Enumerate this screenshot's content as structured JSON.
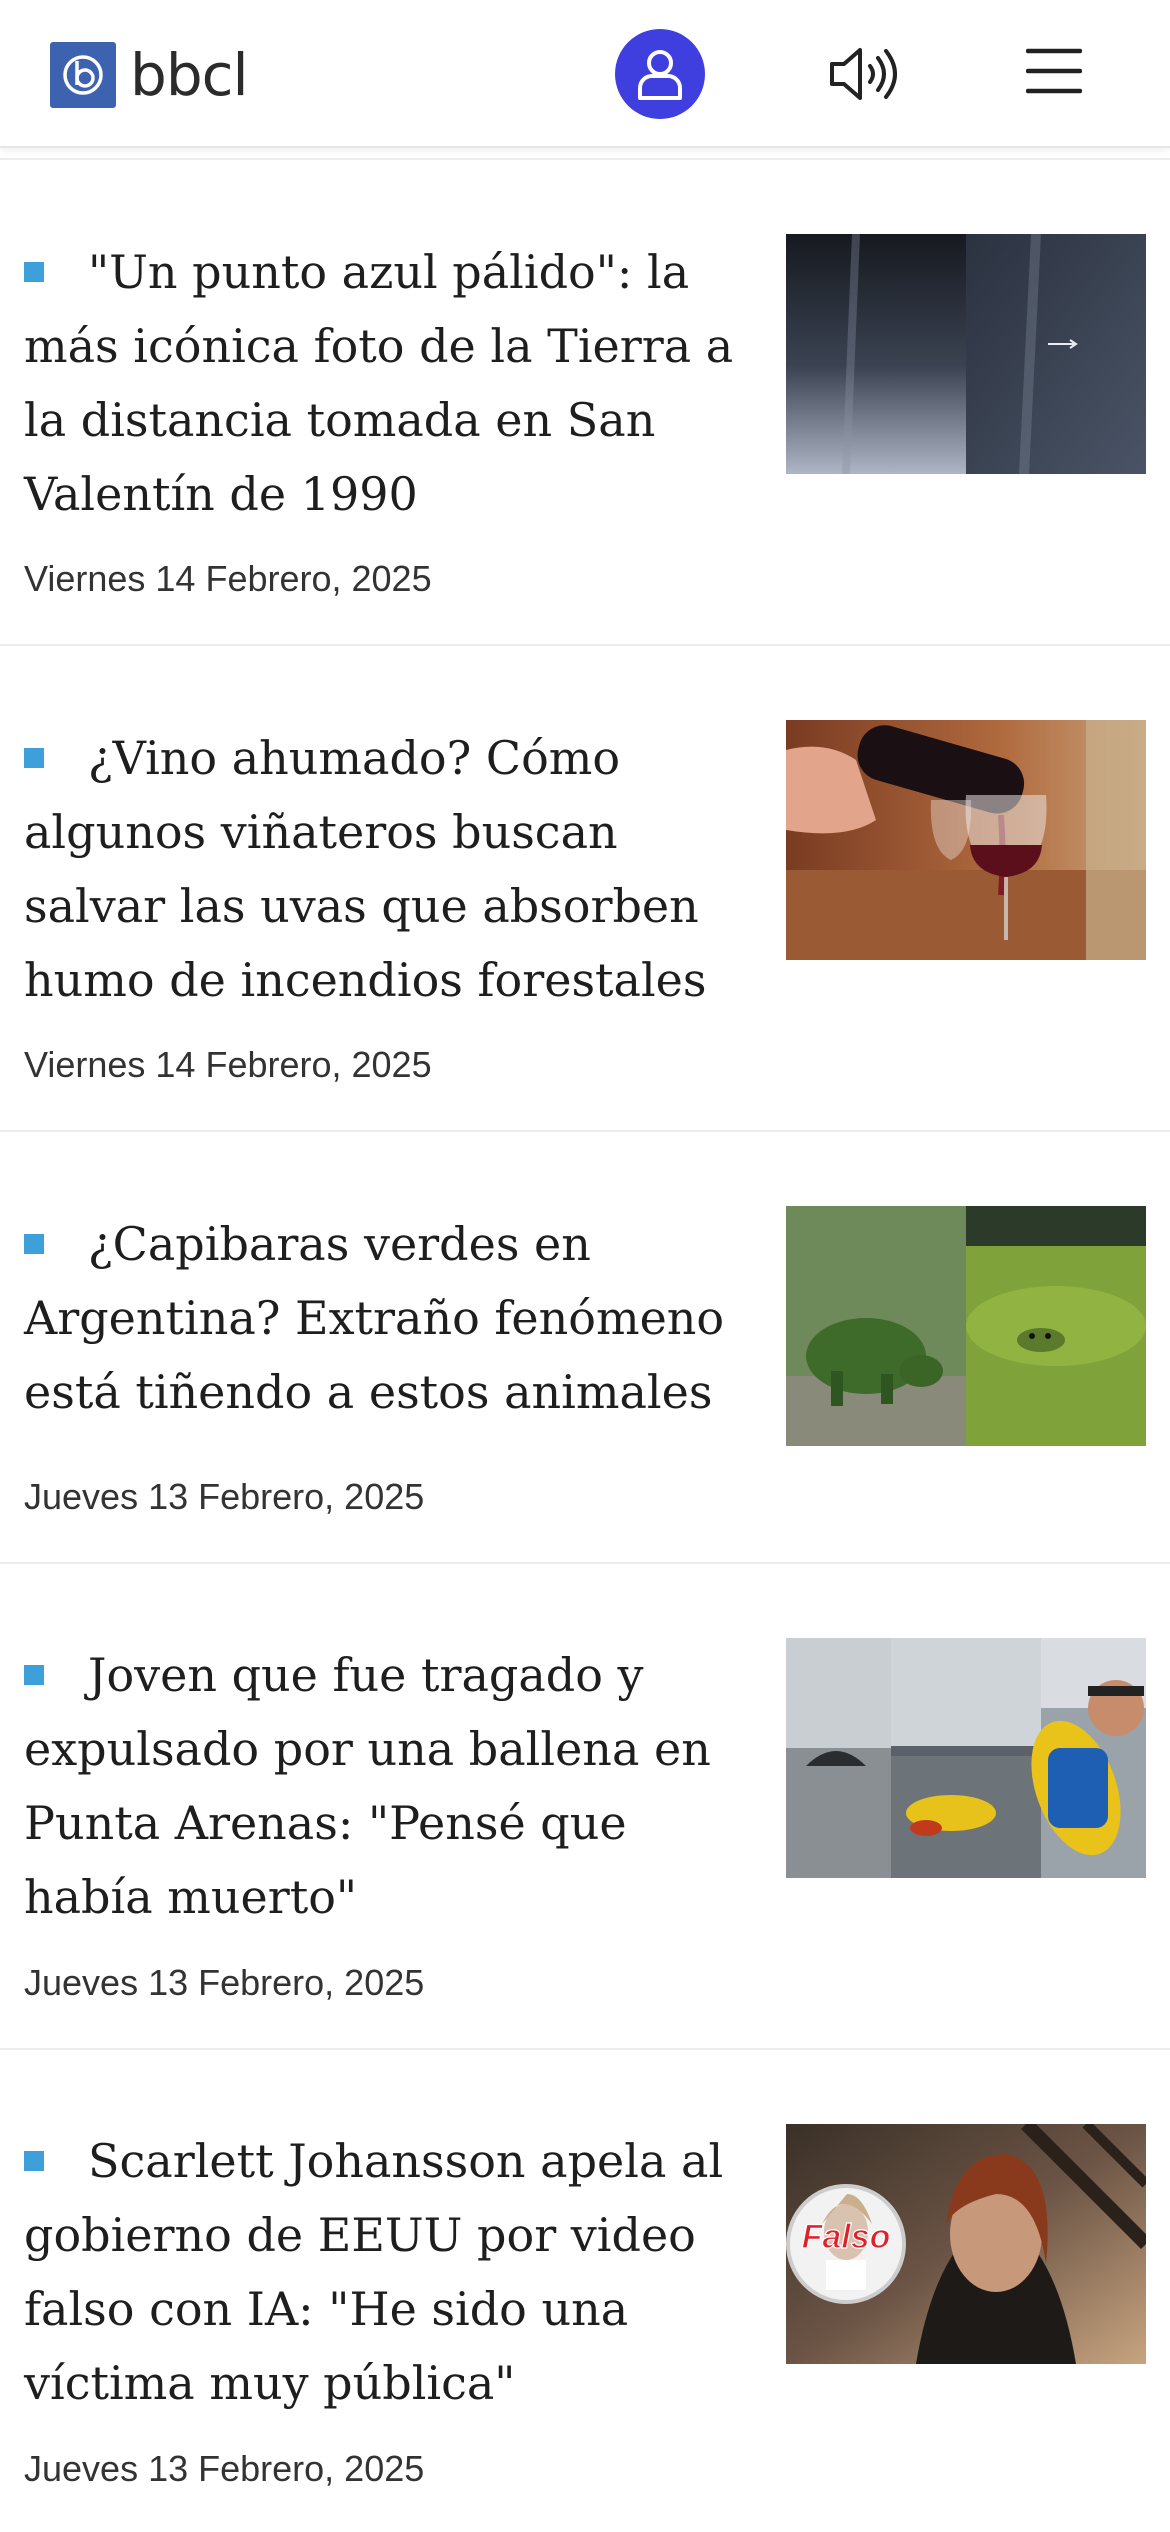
{
  "header": {
    "logo_text": "bbcl",
    "icons": [
      "bbcl-logo-icon",
      "user-icon",
      "speaker-icon",
      "menu-icon"
    ],
    "accent_color": "#3f3fe0",
    "logo_color": "#3d63b0"
  },
  "articles": [
    {
      "title": "\"Un punto azul pálido\": la más icónica foto de la Tierra a la distancia tomada en San Valentín de 1990",
      "date": "Viernes 14 Febrero, 2025"
    },
    {
      "title": "¿Vino ahumado? Cómo algunos viñateros buscan salvar las uvas que absorben humo de incendios forestales",
      "date": "Viernes 14 Febrero, 2025"
    },
    {
      "title": "¿Capibaras verdes en Argentina? Extraño fenómeno está tiñendo a estos animales",
      "date": "Jueves 13 Febrero, 2025"
    },
    {
      "title": "Joven que fue tragado y expulsado por una ballena en Punta Arenas: \"Pensé que había muerto\"",
      "date": "Jueves 13 Febrero, 2025"
    },
    {
      "title": "Scarlett Johansson apela al gobierno de EEUU por video falso con IA: \"He sido una víctima muy pública\"",
      "date": "Jueves 13 Febrero, 2025",
      "image_overlay_text": "Falso"
    }
  ],
  "bullet_color": "#3da0da"
}
